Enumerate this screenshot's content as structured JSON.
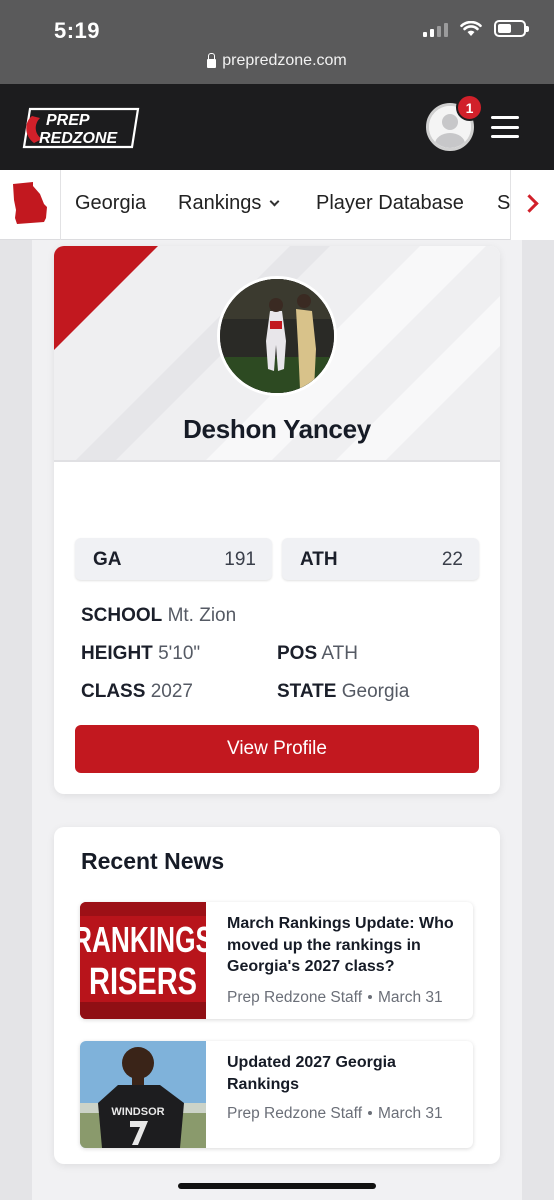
{
  "status_bar": {
    "time": "5:19",
    "url": "prepredzone.com"
  },
  "header": {
    "logo_top": "PREP",
    "logo_bottom": "REDZONE",
    "notification_count": "1",
    "colors": {
      "header_bg": "#1c1c1e",
      "brand_red": "#d1202a"
    }
  },
  "nav": {
    "items": [
      {
        "label": "Georgia"
      },
      {
        "label": "Rankings"
      },
      {
        "label": "Player Database"
      },
      {
        "label": "S"
      }
    ]
  },
  "player": {
    "name": "Deshon Yancey",
    "rankings": [
      {
        "key": "GA",
        "value": "191"
      },
      {
        "key": "ATH",
        "value": "22"
      }
    ],
    "school_label": "SCHOOL",
    "school": "Mt. Zion",
    "height_label": "HEIGHT",
    "height": "5'10\"",
    "pos_label": "POS",
    "pos": "ATH",
    "class_label": "CLASS",
    "class": "2027",
    "state_label": "STATE",
    "state": "Georgia",
    "view_button": "View Profile"
  },
  "news": {
    "title": "Recent News",
    "items": [
      {
        "thumb_line1": "RANKINGS",
        "thumb_line2": "RISERS",
        "headline": "March Rankings Update: Who moved up the rankings in Georgia's 2027 class?",
        "author": "Prep Redzone Staff",
        "date": "March 31"
      },
      {
        "thumb_jersey": "WINDSOR",
        "headline": "Updated 2027 Georgia Rankings",
        "author": "Prep Redzone Staff",
        "date": "March 31"
      }
    ]
  }
}
